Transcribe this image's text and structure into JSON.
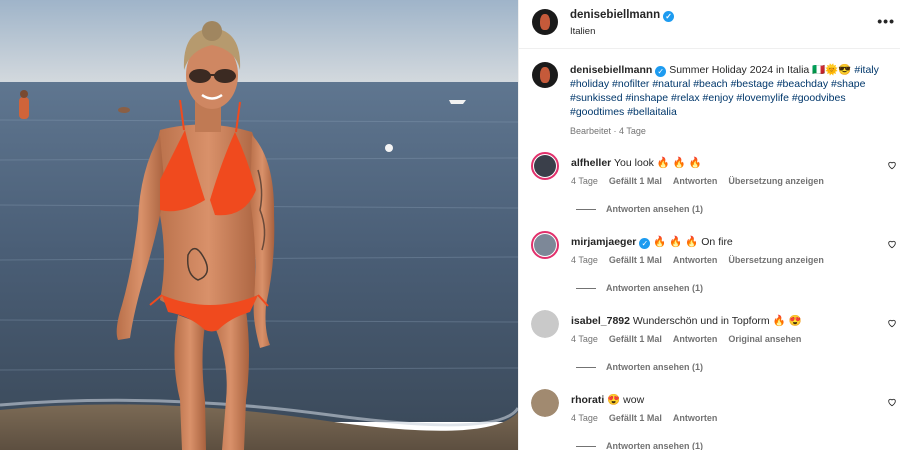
{
  "post": {
    "username": "denisebiellmann",
    "location": "Italien",
    "caption_text": "Summer Holiday 2024 in Italia",
    "caption_emojis": "🇮🇹🌞😎",
    "hashtags": [
      "#italy",
      "#holiday",
      "#nofilter",
      "#natural",
      "#beach",
      "#bestage",
      "#beachday",
      "#shape",
      "#sunkissed",
      "#inshape",
      "#relax",
      "#enjoy",
      "#lovemylife",
      "#goodvibes",
      "#goodtimes",
      "#bellaitalia"
    ],
    "edited_meta": "Bearbeitet · 4 Tage",
    "more_icon": "ellipsis-icon"
  },
  "comments": [
    {
      "username": "alfheller",
      "text": "You look",
      "emojis": "🔥 🔥 🔥",
      "time": "4 Tage",
      "likes": "Gefällt 1 Mal",
      "reply": "Antworten",
      "translate": "Übersetzung anzeigen",
      "view_replies": "Antworten ansehen (1)"
    },
    {
      "username": "mirjamjaeger",
      "verified": true,
      "text": "On fire",
      "emojis": "🔥 🔥 🔥",
      "time": "4 Tage",
      "likes": "Gefällt 1 Mal",
      "reply": "Antworten",
      "translate": "Übersetzung anzeigen",
      "view_replies": "Antworten ansehen (1)"
    },
    {
      "username": "isabel_7892",
      "text": "Wunderschön und in Topform",
      "emojis": "🔥 😍",
      "time": "4 Tage",
      "likes": "Gefällt 1 Mal",
      "reply": "Antworten",
      "translate": "Original ansehen",
      "view_replies": "Antworten ansehen (1)"
    },
    {
      "username": "rhorati",
      "text": "wow",
      "emojis": "😍",
      "time": "4 Tage",
      "likes": "Gefällt 1 Mal",
      "reply": "Antworten",
      "view_replies": "Antworten ansehen (1)"
    }
  ],
  "colors": {
    "sky": "#c9d3dc",
    "sea": "#50647c",
    "bikini": "#f04a1e",
    "hashtag": "#00376b",
    "verified": "#1d9bf0"
  }
}
